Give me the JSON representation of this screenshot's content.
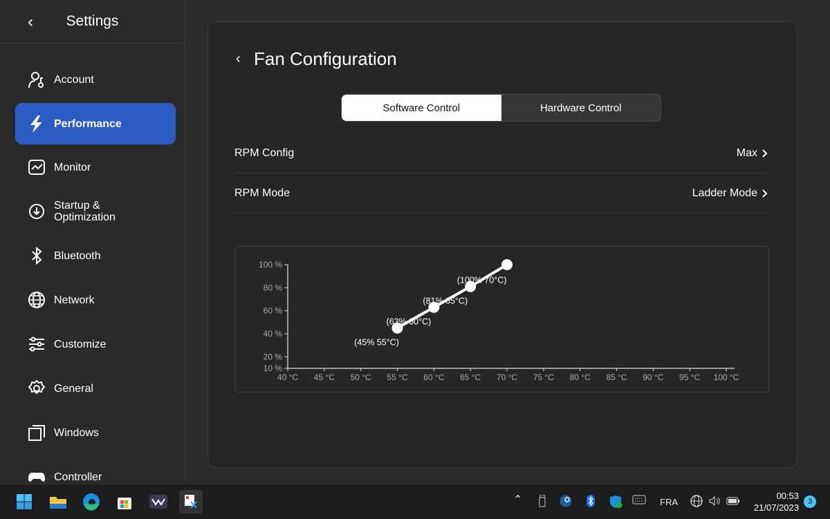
{
  "sidebar": {
    "title": "Settings",
    "items": [
      {
        "label": "Account",
        "icon": "account-icon"
      },
      {
        "label": "Performance",
        "icon": "lightning-icon",
        "active": true
      },
      {
        "label": "Monitor",
        "icon": "monitor-icon"
      },
      {
        "label": "Startup &\nOptimization",
        "icon": "startup-icon"
      },
      {
        "label": "Bluetooth",
        "icon": "bluetooth-icon"
      },
      {
        "label": "Network",
        "icon": "globe-icon"
      },
      {
        "label": "Customize",
        "icon": "sliders-icon"
      },
      {
        "label": "General",
        "icon": "gear-icon"
      },
      {
        "label": "Windows",
        "icon": "windows-icon"
      },
      {
        "label": "Controller",
        "icon": "gamepad-icon"
      }
    ]
  },
  "panel": {
    "title": "Fan Configuration",
    "tabs": [
      "Software Control",
      "Hardware Control"
    ],
    "active_tab": 0,
    "rows": [
      {
        "label": "RPM Config",
        "value": "Max"
      },
      {
        "label": "RPM Mode",
        "value": "Ladder Mode"
      }
    ]
  },
  "accent": "#2c5bc4",
  "chart_data": {
    "type": "line",
    "x": [
      55,
      60,
      65,
      70
    ],
    "y": [
      45,
      63,
      81,
      100
    ],
    "point_labels": [
      "(45% 55°C)",
      "(63% 60°C)",
      "(81% 65°C)",
      "(100% 70°C)"
    ],
    "xlim": [
      40,
      100
    ],
    "ylim": [
      10,
      100
    ],
    "xticks": [
      "40 °C",
      "45 °C",
      "50 °C",
      "55 °C",
      "60 °C",
      "65 °C",
      "70 °C",
      "75 °C",
      "80 °C",
      "85 °C",
      "90 °C",
      "95 °C",
      "100 °C"
    ],
    "yticks": [
      {
        "v": 100,
        "t": "100 %"
      },
      {
        "v": 80,
        "t": "80 %"
      },
      {
        "v": 60,
        "t": "60 %"
      },
      {
        "v": 40,
        "t": "40 %"
      },
      {
        "v": 20,
        "t": "20 %"
      },
      {
        "v": 10,
        "t": "10 %"
      }
    ],
    "grid": false
  },
  "taskbar": {
    "apps": [
      "start",
      "file-explorer",
      "edge",
      "store",
      "app",
      "snipping-tool"
    ],
    "language": "FRA",
    "time": "00:53",
    "date": "21/07/2023",
    "notifications": "3"
  }
}
